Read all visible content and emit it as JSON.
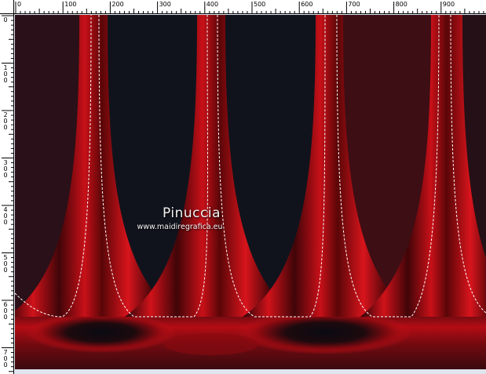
{
  "rulers": {
    "horizontal_labels": [
      "0",
      "100",
      "200",
      "300",
      "400",
      "500",
      "600",
      "700",
      "800",
      "900"
    ],
    "vertical_labels": [
      "0",
      "100",
      "200",
      "300",
      "400",
      "500",
      "600",
      "700"
    ]
  },
  "watermark": {
    "name": "Pinuccia",
    "url": "www.maidiregrafica.eu"
  },
  "colors": {
    "canvas_dark_navy": "#10131c",
    "canvas_dark_plum": "#2a1018",
    "canvas_dark_maroon": "#3d0e14",
    "accent_red": "#c40c12",
    "ruler_background": "#ffffff"
  }
}
